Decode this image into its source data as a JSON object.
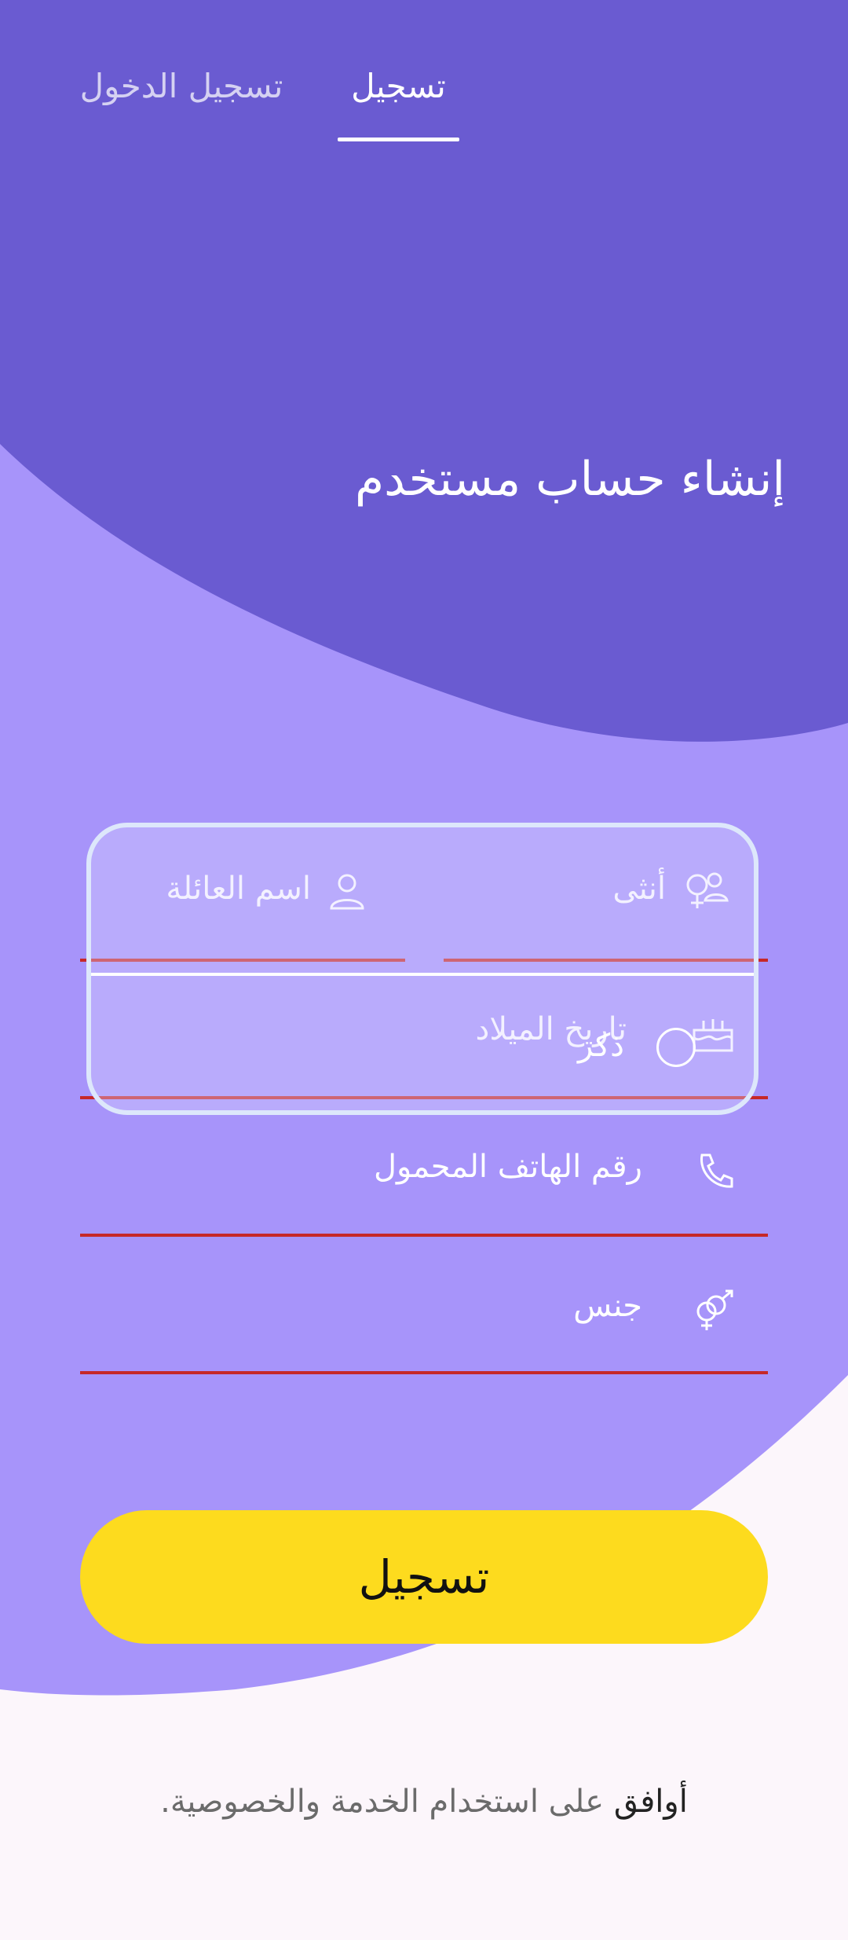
{
  "tabs": {
    "login_label": "تسجيل الدخول",
    "register_label": "تسجيل"
  },
  "title": "إنشاء حساب مستخدم",
  "fields": {
    "family_name": {
      "label": "اسم العائلة",
      "icon": "person-icon"
    },
    "first_name_overlay": {
      "label": "أنثى",
      "icon": "people-icon"
    },
    "birth_date": {
      "label": "تاريخ الميلاد",
      "icon": "cake-icon"
    },
    "birth_date_overlay": "ذكر",
    "phone": {
      "label": "رقم الهاتف المحمول",
      "icon": "phone-icon"
    },
    "gender": {
      "label": "جنس",
      "icon": "gender-icon"
    }
  },
  "submit_label": "تسجيل",
  "terms": {
    "agree": "أوافق",
    "rest": "على استخدام الخدمة والخصوصية."
  },
  "colors": {
    "header_purple": "#6A5BD1",
    "body_purple": "#A794FA",
    "background": "#FCF6FB",
    "button_yellow": "#FDDB1E",
    "underline_red": "#C62828"
  }
}
